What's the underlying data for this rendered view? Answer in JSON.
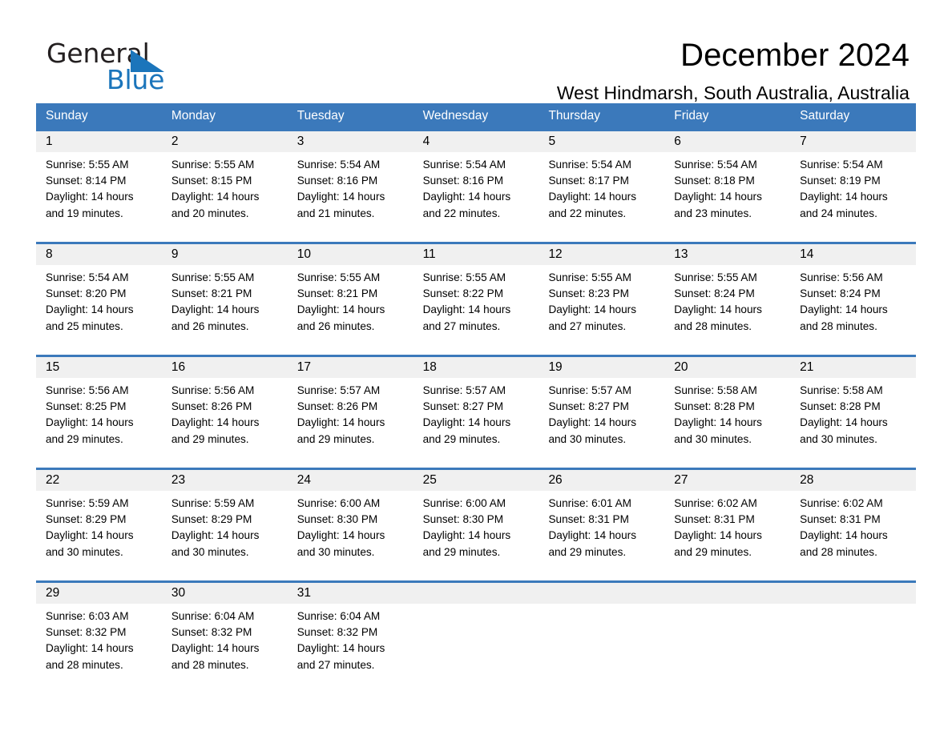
{
  "brand": {
    "name_part1": "General",
    "name_part2": "Blue",
    "triangle_color": "#1b75bb"
  },
  "header": {
    "title": "December 2024",
    "subtitle": "West Hindmarsh, South Australia, Australia"
  },
  "colors": {
    "header_blue": "#3b79bb",
    "daynum_band": "#f0f0f0",
    "text": "#000000"
  },
  "weekdays": [
    "Sunday",
    "Monday",
    "Tuesday",
    "Wednesday",
    "Thursday",
    "Friday",
    "Saturday"
  ],
  "labels": {
    "sunrise_prefix": "Sunrise:",
    "sunset_prefix": "Sunset:",
    "daylight_prefix": "Daylight:"
  },
  "weeks": [
    {
      "days": [
        {
          "num": "1",
          "sunrise": "Sunrise: 5:55 AM",
          "sunset": "Sunset: 8:14 PM",
          "daylight1": "Daylight: 14 hours",
          "daylight2": "and 19 minutes."
        },
        {
          "num": "2",
          "sunrise": "Sunrise: 5:55 AM",
          "sunset": "Sunset: 8:15 PM",
          "daylight1": "Daylight: 14 hours",
          "daylight2": "and 20 minutes."
        },
        {
          "num": "3",
          "sunrise": "Sunrise: 5:54 AM",
          "sunset": "Sunset: 8:16 PM",
          "daylight1": "Daylight: 14 hours",
          "daylight2": "and 21 minutes."
        },
        {
          "num": "4",
          "sunrise": "Sunrise: 5:54 AM",
          "sunset": "Sunset: 8:16 PM",
          "daylight1": "Daylight: 14 hours",
          "daylight2": "and 22 minutes."
        },
        {
          "num": "5",
          "sunrise": "Sunrise: 5:54 AM",
          "sunset": "Sunset: 8:17 PM",
          "daylight1": "Daylight: 14 hours",
          "daylight2": "and 22 minutes."
        },
        {
          "num": "6",
          "sunrise": "Sunrise: 5:54 AM",
          "sunset": "Sunset: 8:18 PM",
          "daylight1": "Daylight: 14 hours",
          "daylight2": "and 23 minutes."
        },
        {
          "num": "7",
          "sunrise": "Sunrise: 5:54 AM",
          "sunset": "Sunset: 8:19 PM",
          "daylight1": "Daylight: 14 hours",
          "daylight2": "and 24 minutes."
        }
      ]
    },
    {
      "days": [
        {
          "num": "8",
          "sunrise": "Sunrise: 5:54 AM",
          "sunset": "Sunset: 8:20 PM",
          "daylight1": "Daylight: 14 hours",
          "daylight2": "and 25 minutes."
        },
        {
          "num": "9",
          "sunrise": "Sunrise: 5:55 AM",
          "sunset": "Sunset: 8:21 PM",
          "daylight1": "Daylight: 14 hours",
          "daylight2": "and 26 minutes."
        },
        {
          "num": "10",
          "sunrise": "Sunrise: 5:55 AM",
          "sunset": "Sunset: 8:21 PM",
          "daylight1": "Daylight: 14 hours",
          "daylight2": "and 26 minutes."
        },
        {
          "num": "11",
          "sunrise": "Sunrise: 5:55 AM",
          "sunset": "Sunset: 8:22 PM",
          "daylight1": "Daylight: 14 hours",
          "daylight2": "and 27 minutes."
        },
        {
          "num": "12",
          "sunrise": "Sunrise: 5:55 AM",
          "sunset": "Sunset: 8:23 PM",
          "daylight1": "Daylight: 14 hours",
          "daylight2": "and 27 minutes."
        },
        {
          "num": "13",
          "sunrise": "Sunrise: 5:55 AM",
          "sunset": "Sunset: 8:24 PM",
          "daylight1": "Daylight: 14 hours",
          "daylight2": "and 28 minutes."
        },
        {
          "num": "14",
          "sunrise": "Sunrise: 5:56 AM",
          "sunset": "Sunset: 8:24 PM",
          "daylight1": "Daylight: 14 hours",
          "daylight2": "and 28 minutes."
        }
      ]
    },
    {
      "days": [
        {
          "num": "15",
          "sunrise": "Sunrise: 5:56 AM",
          "sunset": "Sunset: 8:25 PM",
          "daylight1": "Daylight: 14 hours",
          "daylight2": "and 29 minutes."
        },
        {
          "num": "16",
          "sunrise": "Sunrise: 5:56 AM",
          "sunset": "Sunset: 8:26 PM",
          "daylight1": "Daylight: 14 hours",
          "daylight2": "and 29 minutes."
        },
        {
          "num": "17",
          "sunrise": "Sunrise: 5:57 AM",
          "sunset": "Sunset: 8:26 PM",
          "daylight1": "Daylight: 14 hours",
          "daylight2": "and 29 minutes."
        },
        {
          "num": "18",
          "sunrise": "Sunrise: 5:57 AM",
          "sunset": "Sunset: 8:27 PM",
          "daylight1": "Daylight: 14 hours",
          "daylight2": "and 29 minutes."
        },
        {
          "num": "19",
          "sunrise": "Sunrise: 5:57 AM",
          "sunset": "Sunset: 8:27 PM",
          "daylight1": "Daylight: 14 hours",
          "daylight2": "and 30 minutes."
        },
        {
          "num": "20",
          "sunrise": "Sunrise: 5:58 AM",
          "sunset": "Sunset: 8:28 PM",
          "daylight1": "Daylight: 14 hours",
          "daylight2": "and 30 minutes."
        },
        {
          "num": "21",
          "sunrise": "Sunrise: 5:58 AM",
          "sunset": "Sunset: 8:28 PM",
          "daylight1": "Daylight: 14 hours",
          "daylight2": "and 30 minutes."
        }
      ]
    },
    {
      "days": [
        {
          "num": "22",
          "sunrise": "Sunrise: 5:59 AM",
          "sunset": "Sunset: 8:29 PM",
          "daylight1": "Daylight: 14 hours",
          "daylight2": "and 30 minutes."
        },
        {
          "num": "23",
          "sunrise": "Sunrise: 5:59 AM",
          "sunset": "Sunset: 8:29 PM",
          "daylight1": "Daylight: 14 hours",
          "daylight2": "and 30 minutes."
        },
        {
          "num": "24",
          "sunrise": "Sunrise: 6:00 AM",
          "sunset": "Sunset: 8:30 PM",
          "daylight1": "Daylight: 14 hours",
          "daylight2": "and 30 minutes."
        },
        {
          "num": "25",
          "sunrise": "Sunrise: 6:00 AM",
          "sunset": "Sunset: 8:30 PM",
          "daylight1": "Daylight: 14 hours",
          "daylight2": "and 29 minutes."
        },
        {
          "num": "26",
          "sunrise": "Sunrise: 6:01 AM",
          "sunset": "Sunset: 8:31 PM",
          "daylight1": "Daylight: 14 hours",
          "daylight2": "and 29 minutes."
        },
        {
          "num": "27",
          "sunrise": "Sunrise: 6:02 AM",
          "sunset": "Sunset: 8:31 PM",
          "daylight1": "Daylight: 14 hours",
          "daylight2": "and 29 minutes."
        },
        {
          "num": "28",
          "sunrise": "Sunrise: 6:02 AM",
          "sunset": "Sunset: 8:31 PM",
          "daylight1": "Daylight: 14 hours",
          "daylight2": "and 28 minutes."
        }
      ]
    },
    {
      "days": [
        {
          "num": "29",
          "sunrise": "Sunrise: 6:03 AM",
          "sunset": "Sunset: 8:32 PM",
          "daylight1": "Daylight: 14 hours",
          "daylight2": "and 28 minutes."
        },
        {
          "num": "30",
          "sunrise": "Sunrise: 6:04 AM",
          "sunset": "Sunset: 8:32 PM",
          "daylight1": "Daylight: 14 hours",
          "daylight2": "and 28 minutes."
        },
        {
          "num": "31",
          "sunrise": "Sunrise: 6:04 AM",
          "sunset": "Sunset: 8:32 PM",
          "daylight1": "Daylight: 14 hours",
          "daylight2": "and 27 minutes."
        },
        {
          "num": "",
          "sunrise": "",
          "sunset": "",
          "daylight1": "",
          "daylight2": ""
        },
        {
          "num": "",
          "sunrise": "",
          "sunset": "",
          "daylight1": "",
          "daylight2": ""
        },
        {
          "num": "",
          "sunrise": "",
          "sunset": "",
          "daylight1": "",
          "daylight2": ""
        },
        {
          "num": "",
          "sunrise": "",
          "sunset": "",
          "daylight1": "",
          "daylight2": ""
        }
      ]
    }
  ]
}
